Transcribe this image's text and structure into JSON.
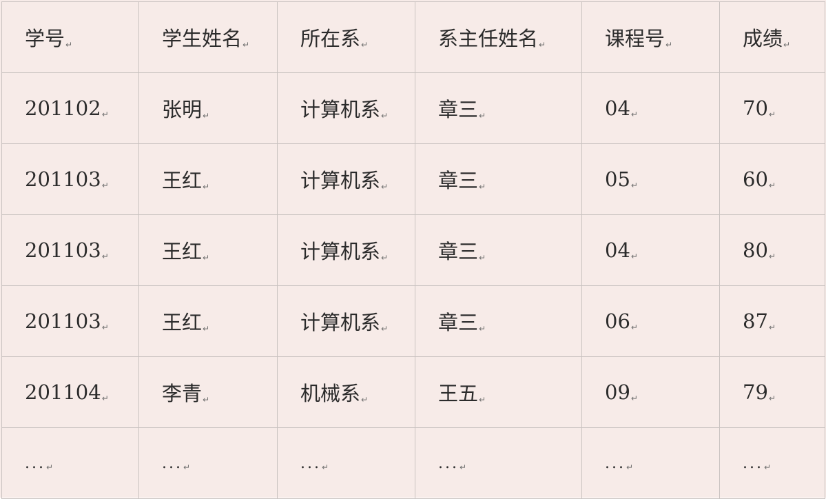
{
  "table": {
    "headers": [
      "学号",
      "学生姓名",
      "所在系",
      "系主任姓名",
      "课程号",
      "成绩"
    ],
    "rows": [
      [
        "201102",
        "张明",
        "计算机系",
        "章三",
        "04",
        "70"
      ],
      [
        "201103",
        "王红",
        "计算机系",
        "章三",
        "05",
        "60"
      ],
      [
        "201103",
        "王红",
        "计算机系",
        "章三",
        "04",
        "80"
      ],
      [
        "201103",
        "王红",
        "计算机系",
        "章三",
        "06",
        "87"
      ],
      [
        "201104",
        "李青",
        "机械系",
        "王五",
        "09",
        "79"
      ],
      [
        "...",
        "...",
        "...",
        "...",
        "...",
        "..."
      ]
    ],
    "paragraph_mark": "↵"
  }
}
